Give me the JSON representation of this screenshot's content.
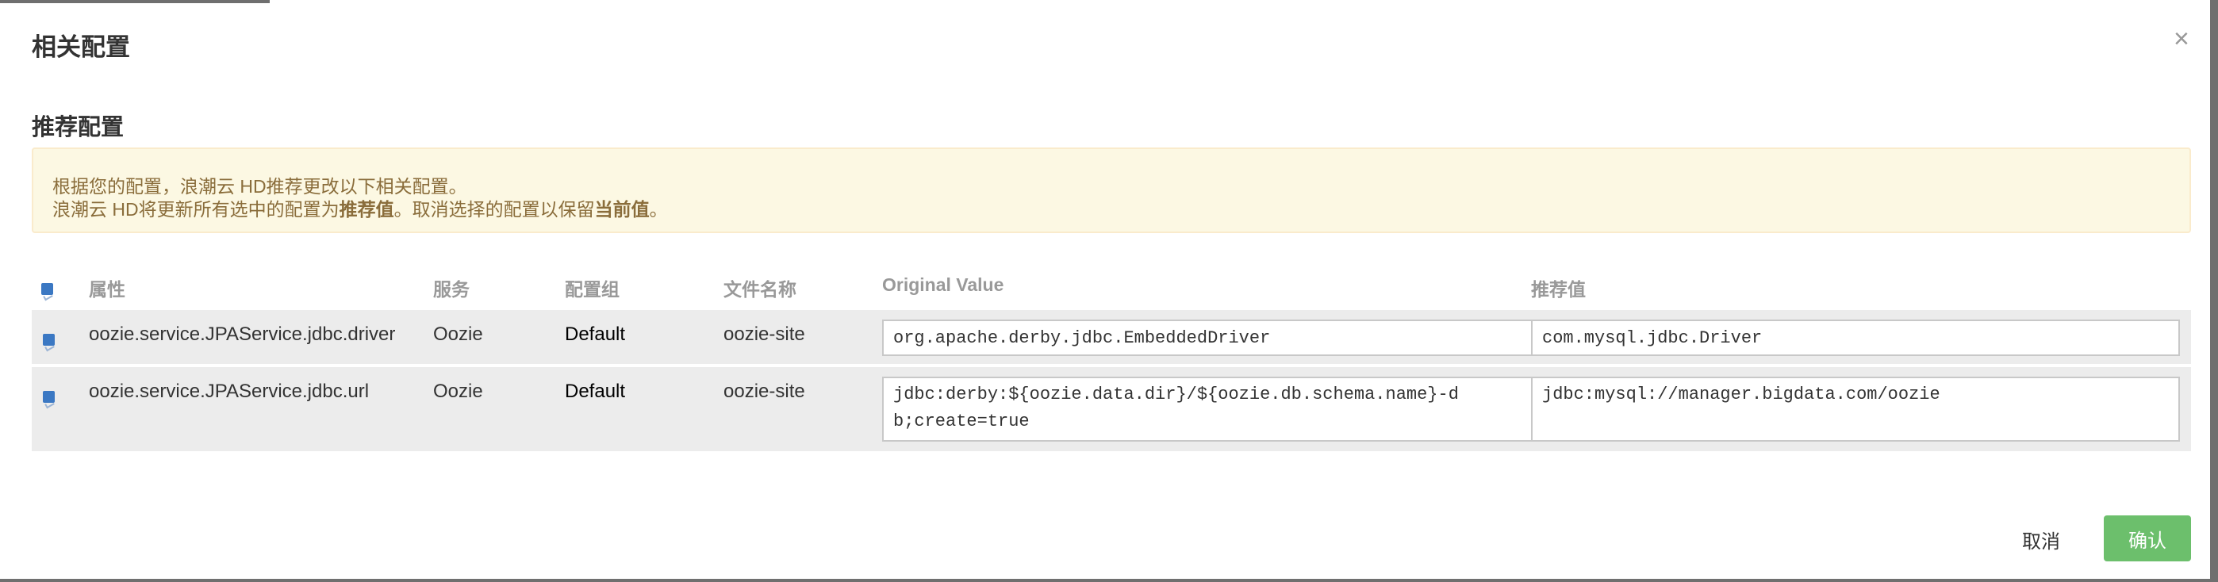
{
  "modal": {
    "title": "相关配置",
    "close_label": "×"
  },
  "section": {
    "title": "推荐配置"
  },
  "alert": {
    "line1": "根据您的配置，浪潮云 HD推荐更改以下相关配置。",
    "line2_part1": "浪潮云 HD将更新所有选中的配置为",
    "line2_bold1": "推荐值",
    "line2_part2": "。取消选择的配置以保留",
    "line2_bold2": "当前值",
    "line2_part3": "。"
  },
  "table": {
    "headers": {
      "property": "属性",
      "service": "服务",
      "group": "配置组",
      "filename": "文件名称",
      "original": "Original Value",
      "recommended": "推荐值"
    },
    "rows": [
      {
        "checked": true,
        "property": "oozie.service.JPAService.jdbc.driver",
        "service": "Oozie",
        "group": "Default",
        "filename": "oozie-site",
        "original": "org.apache.derby.jdbc.EmbeddedDriver",
        "recommended": "com.mysql.jdbc.Driver"
      },
      {
        "checked": true,
        "property": "oozie.service.JPAService.jdbc.url",
        "service": "Oozie",
        "group": "Default",
        "filename": "oozie-site",
        "original_line1": "jdbc:derby:${oozie.data.dir}/${oozie.db.schema.name}-d",
        "original_line2": "b;create=true",
        "recommended": "jdbc:mysql://manager.bigdata.com/oozie"
      }
    ]
  },
  "footer": {
    "cancel_label": "取消",
    "confirm_label": "确认"
  },
  "colors": {
    "alert_bg": "#fcf8e3",
    "alert_text": "#8a6d3b",
    "checkbox": "#3b78c3",
    "confirm_button": "#6cbf6c",
    "row_bg": "#ececec"
  }
}
